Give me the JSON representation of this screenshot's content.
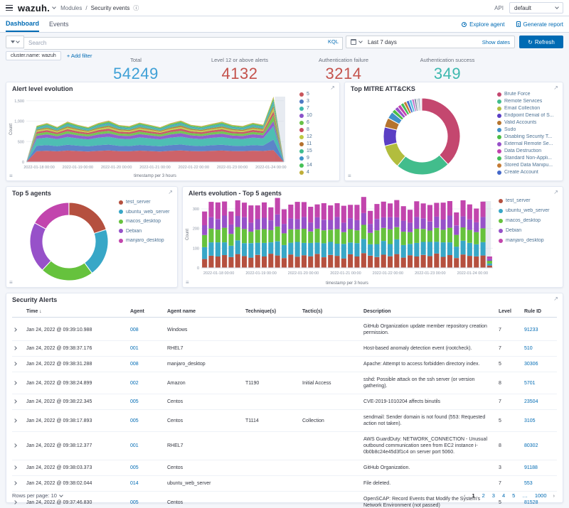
{
  "topbar": {
    "logo": "wazuh.",
    "breadcrumb_module": "Modules",
    "breadcrumb_separator": "/",
    "breadcrumb_page": "Security events",
    "api_label": "API",
    "index_pattern": "default"
  },
  "tabs": {
    "dashboard": "Dashboard",
    "events": "Events",
    "explore_agent": "Explore agent",
    "generate_report": "Generate report"
  },
  "search": {
    "placeholder": "Search",
    "kql_label": "KQL",
    "time_range": "Last 7 days",
    "show_dates": "Show dates",
    "refresh_label": "Refresh",
    "filter_chip": "cluster.name: wazuh",
    "add_filter": "+ Add filter"
  },
  "icons": {
    "info": "ⓘ",
    "refresh": "↻",
    "expand": "↗",
    "sort_desc": "↓",
    "legend_toggle": "≡",
    "prev": "‹",
    "next": "›"
  },
  "stats": [
    {
      "label": "Total",
      "value": "54249",
      "color": "#3ea0d6"
    },
    {
      "label": "Level 12 or above alerts",
      "value": "4132",
      "color": "#c4524c"
    },
    {
      "label": "Authentication failure",
      "value": "3214",
      "color": "#c4524c"
    },
    {
      "label": "Authentication success",
      "value": "349",
      "color": "#3cb8ae"
    }
  ],
  "chart_data": [
    {
      "type": "area",
      "title": "Alert level evolution",
      "xlabel": "timestamp per 3 hours",
      "ylabel": "Count",
      "ylim": [
        0,
        1600
      ],
      "yticks": [
        0,
        500,
        1000,
        1500
      ],
      "categories": [
        "2022-01-18 00:00",
        "2022-01-19 00:00",
        "2022-01-20 00:00",
        "2022-01-21 00:00",
        "2022-01-22 00:00",
        "2022-01-23 00:00",
        "2022-01-24 00:00"
      ],
      "tick_fractions": [
        0.05,
        0.2,
        0.35,
        0.5,
        0.65,
        0.8,
        0.95
      ],
      "series": [
        {
          "name": "5",
          "color": "#c9565c",
          "values": [
            0,
            265,
            275,
            260,
            280,
            268,
            258,
            272,
            282,
            266,
            262,
            278,
            268,
            258,
            274,
            284,
            268,
            262,
            274,
            280,
            268,
            264,
            276,
            270,
            290,
            5
          ]
        },
        {
          "name": "3",
          "color": "#4e79c4",
          "values": [
            0,
            130,
            138,
            128,
            142,
            132,
            126,
            138,
            144,
            130,
            128,
            140,
            132,
            126,
            138,
            144,
            132,
            128,
            136,
            142,
            130,
            128,
            138,
            132,
            260,
            5
          ]
        },
        {
          "name": "7",
          "color": "#3fb8ac",
          "values": [
            0,
            175,
            185,
            172,
            190,
            178,
            170,
            184,
            192,
            176,
            172,
            186,
            178,
            170,
            184,
            192,
            178,
            172,
            182,
            188,
            176,
            172,
            184,
            178,
            330,
            5
          ]
        },
        {
          "name": "10",
          "color": "#8a52c9",
          "values": [
            0,
            72,
            78,
            70,
            82,
            74,
            70,
            80,
            84,
            74,
            72,
            80,
            74,
            70,
            78,
            84,
            74,
            72,
            78,
            82,
            74,
            72,
            80,
            74,
            120,
            3
          ]
        },
        {
          "name": "6",
          "color": "#68c147",
          "values": [
            0,
            52,
            58,
            50,
            60,
            54,
            50,
            58,
            62,
            54,
            52,
            58,
            54,
            50,
            58,
            62,
            54,
            52,
            56,
            60,
            54,
            52,
            58,
            54,
            150,
            3
          ]
        },
        {
          "name": "8",
          "color": "#c74a5e",
          "values": [
            0,
            42,
            46,
            40,
            50,
            44,
            40,
            48,
            52,
            44,
            42,
            48,
            44,
            40,
            46,
            52,
            44,
            42,
            46,
            50,
            44,
            42,
            48,
            44,
            90,
            2
          ]
        },
        {
          "name": "12",
          "color": "#bdc943",
          "values": [
            0,
            32,
            36,
            30,
            38,
            34,
            30,
            36,
            40,
            34,
            32,
            36,
            34,
            30,
            36,
            40,
            34,
            32,
            34,
            38,
            34,
            32,
            36,
            34,
            80,
            2
          ]
        },
        {
          "name": "11",
          "color": "#b5712e",
          "values": [
            0,
            22,
            26,
            20,
            28,
            24,
            20,
            26,
            30,
            24,
            22,
            26,
            24,
            20,
            26,
            30,
            24,
            22,
            24,
            28,
            24,
            22,
            26,
            24,
            50,
            2
          ]
        },
        {
          "name": "15",
          "color": "#3fbd8f",
          "values": [
            0,
            28,
            32,
            26,
            34,
            30,
            26,
            32,
            36,
            30,
            28,
            32,
            30,
            26,
            32,
            36,
            30,
            28,
            30,
            34,
            30,
            28,
            32,
            30,
            70,
            2
          ]
        },
        {
          "name": "9",
          "color": "#3f93c9",
          "values": [
            0,
            22,
            25,
            20,
            27,
            23,
            20,
            26,
            29,
            23,
            22,
            26,
            23,
            20,
            25,
            29,
            23,
            22,
            24,
            27,
            23,
            22,
            26,
            23,
            55,
            2
          ]
        },
        {
          "name": "14",
          "color": "#46c157",
          "values": [
            0,
            26,
            30,
            24,
            32,
            28,
            24,
            30,
            34,
            28,
            26,
            30,
            28,
            24,
            30,
            34,
            28,
            26,
            28,
            32,
            28,
            26,
            30,
            28,
            60,
            2
          ]
        },
        {
          "name": "4",
          "color": "#bfae39",
          "values": [
            0,
            20,
            23,
            18,
            25,
            21,
            18,
            24,
            27,
            21,
            20,
            24,
            21,
            18,
            23,
            27,
            21,
            20,
            22,
            25,
            21,
            20,
            24,
            21,
            45,
            2
          ]
        }
      ]
    },
    {
      "type": "pie",
      "title": "Top MITRE ATT&CKS",
      "slices": [
        {
          "label": "Brute Force",
          "value": 38,
          "color": "#c4476f"
        },
        {
          "label": "Remote Services",
          "value": 23,
          "color": "#42bd8c"
        },
        {
          "label": "Email Collection",
          "value": 10,
          "color": "#b2bd3e"
        },
        {
          "label": "Endpoint Denial of S...",
          "value": 8,
          "color": "#5b3fc4"
        },
        {
          "label": "Valid Accounts",
          "value": 4,
          "color": "#b5742e"
        },
        {
          "label": "Sudo",
          "value": 3,
          "color": "#4090c9"
        },
        {
          "label": "Disabling Security T...",
          "value": 1.6,
          "color": "#4cbd47"
        },
        {
          "label": "External Remote Se...",
          "value": 1.6,
          "color": "#9750c9"
        },
        {
          "label": "Data Destruction",
          "value": 1.5,
          "color": "#c243ae"
        },
        {
          "label": "Standard Non-Appli...",
          "value": 1.4,
          "color": "#43bd57"
        },
        {
          "label": "Stored Data Manipu...",
          "value": 1.3,
          "color": "#c47b35"
        },
        {
          "label": "Create Account",
          "value": 1.2,
          "color": "#4468c9"
        },
        {
          "label": "",
          "value": 1.2,
          "color": "#5bc0de",
          "legend": false
        },
        {
          "label": "",
          "value": 1.0,
          "color": "#bf6fc9",
          "legend": false
        },
        {
          "label": "",
          "value": 0.9,
          "color": "#7a8aa0",
          "legend": false
        },
        {
          "label": "",
          "value": 0.8,
          "color": "#c4cbd6",
          "legend": false
        },
        {
          "label": "",
          "value": 0.8,
          "color": "#98a9bd",
          "legend": false
        },
        {
          "label": "",
          "value": 0.7,
          "color": "#e0e5ee",
          "legend": false
        }
      ]
    },
    {
      "type": "pie",
      "title": "Top 5 agents",
      "slices": [
        {
          "label": "test_server",
          "value": 20,
          "color": "#b5503f"
        },
        {
          "label": "ubuntu_web_server",
          "value": 20,
          "color": "#38a7c7"
        },
        {
          "label": "macos_desktop",
          "value": 22,
          "color": "#66c23d"
        },
        {
          "label": "Debian",
          "value": 21,
          "color": "#9751c9"
        },
        {
          "label": "manjaro_desktop",
          "value": 17,
          "color": "#c245ad"
        }
      ]
    },
    {
      "type": "bar",
      "title": "Alerts evolution - Top 5 agents",
      "xlabel": "timestamp per 3 hours",
      "ylabel": "Count",
      "ylim": [
        0,
        340
      ],
      "yticks": [
        0,
        100,
        200,
        300
      ],
      "categories": [
        "2022-01-18 00:00",
        "2022-01-19 00:00",
        "2022-01-20 00:00",
        "2022-01-21 00:00",
        "2022-01-22 00:00",
        "2022-01-23 00:00",
        "2022-01-24 00:00"
      ],
      "tick_fractions": [
        0.06,
        0.205,
        0.35,
        0.495,
        0.64,
        0.785,
        0.93
      ],
      "series": [
        {
          "name": "test_server",
          "color": "#b5503f",
          "values": [
            45,
            62,
            58,
            65,
            55,
            70,
            60,
            52,
            66,
            58,
            72,
            63,
            50,
            68,
            57,
            64,
            59,
            71,
            54,
            66,
            61,
            48,
            69,
            58,
            75,
            62,
            55,
            67,
            59,
            70,
            52,
            64,
            58,
            66,
            60,
            73,
            56,
            65,
            50,
            68,
            61,
            58,
            63,
            12
          ]
        },
        {
          "name": "ubuntu_web_server",
          "color": "#38a7c7",
          "values": [
            60,
            68,
            72,
            65,
            58,
            70,
            66,
            74,
            62,
            69,
            58,
            72,
            66,
            60,
            75,
            63,
            68,
            58,
            71,
            66,
            62,
            74,
            60,
            68,
            72,
            58,
            66,
            70,
            62,
            75,
            64,
            58,
            69,
            66,
            72,
            60,
            74,
            65,
            58,
            70,
            66,
            62,
            68,
            10
          ]
        },
        {
          "name": "macos_desktop",
          "color": "#66c23d",
          "values": [
            62,
            70,
            65,
            74,
            60,
            68,
            72,
            58,
            66,
            70,
            62,
            75,
            60,
            68,
            64,
            72,
            58,
            70,
            66,
            62,
            74,
            60,
            68,
            65,
            72,
            58,
            70,
            66,
            75,
            62,
            68,
            60,
            72,
            66,
            58,
            70,
            64,
            74,
            60,
            68,
            66,
            62,
            70,
            14
          ]
        },
        {
          "name": "Debian",
          "color": "#9751c9",
          "values": [
            50,
            58,
            54,
            62,
            48,
            56,
            60,
            46,
            54,
            58,
            50,
            62,
            48,
            56,
            52,
            60,
            46,
            58,
            54,
            50,
            62,
            48,
            56,
            52,
            60,
            46,
            58,
            54,
            62,
            50,
            56,
            48,
            60,
            54,
            46,
            58,
            52,
            62,
            48,
            56,
            54,
            50,
            58,
            10
          ]
        },
        {
          "name": "manjaro_desktop",
          "color": "#c245ad",
          "values": [
            70,
            78,
            84,
            72,
            66,
            80,
            74,
            88,
            70,
            78,
            66,
            84,
            74,
            70,
            88,
            76,
            80,
            66,
            84,
            74,
            70,
            86,
            68,
            78,
            82,
            66,
            76,
            80,
            70,
            88,
            74,
            66,
            80,
            76,
            84,
            70,
            86,
            74,
            66,
            82,
            76,
            70,
            78,
            12
          ]
        }
      ]
    }
  ],
  "table": {
    "title": "Security Alerts",
    "columns": [
      "Time",
      "Agent",
      "Agent name",
      "Technique(s)",
      "Tactic(s)",
      "Description",
      "Level",
      "Rule ID"
    ],
    "rows": [
      {
        "time": "Jan 24, 2022 @ 09:39:10.988",
        "agent": "008",
        "agent_name": "Windows",
        "technique": "",
        "tactic": "",
        "description": "GitHub Organization update member repository creation permission.",
        "level": "7",
        "rule_id": "91233"
      },
      {
        "time": "Jan 24, 2022 @ 09:38:37.176",
        "agent": "001",
        "agent_name": "RHEL7",
        "technique": "",
        "tactic": "",
        "description": "Host-based anomaly detection event (rootcheck).",
        "level": "7",
        "rule_id": "510"
      },
      {
        "time": "Jan 24, 2022 @ 09:38:31.288",
        "agent": "008",
        "agent_name": "manjaro_desktop",
        "technique": "",
        "tactic": "",
        "description": "Apache: Attempt to access forbidden directory index.",
        "level": "5",
        "rule_id": "30306"
      },
      {
        "time": "Jan 24, 2022 @ 09:38:24.899",
        "agent": "002",
        "agent_name": "Amazon",
        "technique": "T1190",
        "tactic": "Initial Access",
        "description": "sshd: Possible attack on the ssh server (or version gathering).",
        "level": "8",
        "rule_id": "5701"
      },
      {
        "time": "Jan 24, 2022 @ 09:38:22.345",
        "agent": "005",
        "agent_name": "Centos",
        "technique": "",
        "tactic": "",
        "description": "CVE-2019-1010204 affects binutils",
        "level": "7",
        "rule_id": "23504"
      },
      {
        "time": "Jan 24, 2022 @ 09:38:17.893",
        "agent": "005",
        "agent_name": "Centos",
        "technique": "T1114",
        "tactic": "Collection",
        "description": "sendmail: Sender domain is not found (553: Requested action not taken).",
        "level": "5",
        "rule_id": "3105"
      },
      {
        "time": "Jan 24, 2022 @ 09:38:12.377",
        "agent": "001",
        "agent_name": "RHEL7",
        "technique": "",
        "tactic": "",
        "description": "AWS GuardDuty: NETWORK_CONNECTION - Unusual outbound communication seen from EC2 instance i-0b0b8c24e45d3f1c4 on server port 5060.",
        "level": "8",
        "rule_id": "80302"
      },
      {
        "time": "Jan 24, 2022 @ 09:38:03.373",
        "agent": "005",
        "agent_name": "Centos",
        "technique": "",
        "tactic": "",
        "description": "GitHub Organization.",
        "level": "3",
        "rule_id": "91188"
      },
      {
        "time": "Jan 24, 2022 @ 09:38:02.044",
        "agent": "014",
        "agent_name": "ubuntu_web_server",
        "technique": "",
        "tactic": "",
        "description": "File deleted.",
        "level": "7",
        "rule_id": "553"
      },
      {
        "time": "Jan 24, 2022 @ 09:37:46.830",
        "agent": "005",
        "agent_name": "Centos",
        "technique": "",
        "tactic": "",
        "description": "OpenSCAP: Record Events that Modify the System's Network Environment (not passed)",
        "level": "5",
        "rule_id": "81528"
      }
    ],
    "pagination": {
      "rows_per_page_label": "Rows per page: 10",
      "pages": [
        "1",
        "2",
        "3",
        "4",
        "5",
        "…",
        "1000"
      ],
      "active_page": "1"
    }
  }
}
